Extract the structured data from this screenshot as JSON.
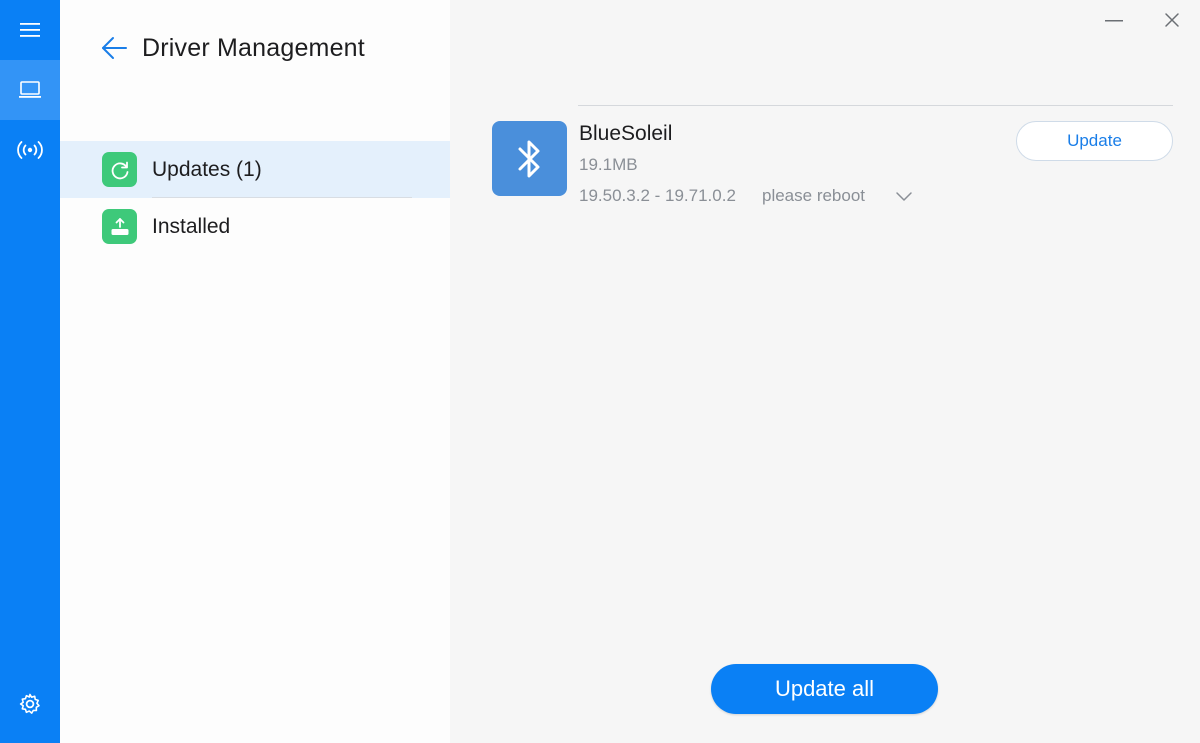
{
  "window": {
    "minimize_icon": "minimize-icon",
    "close_icon": "close-icon"
  },
  "rail": {
    "items": [
      {
        "icon": "menu-icon"
      },
      {
        "icon": "laptop-icon",
        "active": true
      },
      {
        "icon": "broadcast-icon"
      },
      {
        "icon": "gear-icon"
      }
    ],
    "accent": "#0a80f5"
  },
  "panel": {
    "back_icon": "arrow-left-icon",
    "title": "Driver Management",
    "nav": [
      {
        "label": "Updates (1)",
        "icon": "refresh-icon",
        "selected": true
      },
      {
        "label": "Installed",
        "icon": "install-icon",
        "selected": false
      }
    ]
  },
  "drivers": [
    {
      "name": "BlueSoleil",
      "size": "19.1MB",
      "version": "19.50.3.2 - 19.71.0.2",
      "note": "please reboot",
      "icon": "bluetooth-icon",
      "update_label": "Update"
    }
  ],
  "footer": {
    "update_all_label": "Update all"
  },
  "colors": {
    "accent": "#0a80f5",
    "green": "#3ec97a",
    "driver_icon_bg": "#4a8fdb",
    "selected_bg": "#e4f0fc"
  }
}
